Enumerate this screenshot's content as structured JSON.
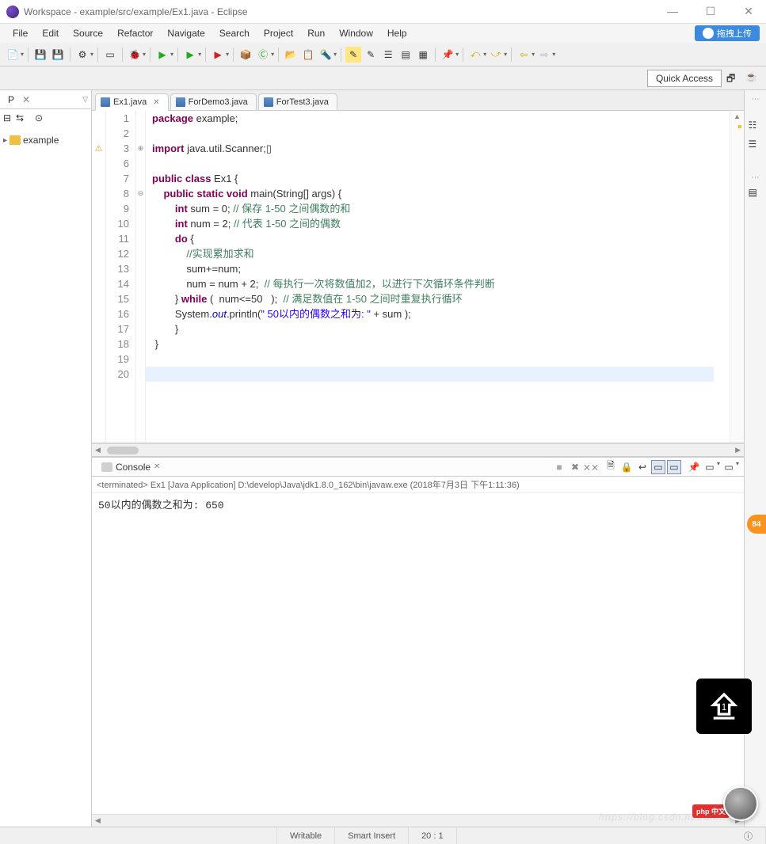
{
  "window": {
    "title": "Workspace - example/src/example/Ex1.java - Eclipse"
  },
  "menu": {
    "items": [
      "File",
      "Edit",
      "Source",
      "Refactor",
      "Navigate",
      "Search",
      "Project",
      "Run",
      "Window",
      "Help"
    ],
    "upload_label": "拖拽上传"
  },
  "quick_access": {
    "label": "Quick Access"
  },
  "explorer": {
    "tab": "P",
    "project": "example"
  },
  "editor": {
    "tabs": [
      {
        "name": "Ex1.java",
        "active": true
      },
      {
        "name": "ForDemo3.java",
        "active": false
      },
      {
        "name": "ForTest3.java",
        "active": false
      }
    ],
    "lines": [
      {
        "n": 1,
        "html": "<span class='k'>package</span> example;"
      },
      {
        "n": 2,
        "html": ""
      },
      {
        "n": 3,
        "html": "<span class='k'>import</span> java.util.Scanner;▯",
        "annot": "warn",
        "fold": "⊕"
      },
      {
        "n": 6,
        "html": ""
      },
      {
        "n": 7,
        "html": "<span class='k'>public class</span> Ex1 {"
      },
      {
        "n": 8,
        "html": "    <span class='k'>public static void</span> main(String[] args) {",
        "fold": "⊖"
      },
      {
        "n": 9,
        "html": "        <span class='k'>int</span> sum = 0; <span class='c'>// 保存 1-50 之间偶数的和</span>"
      },
      {
        "n": 10,
        "html": "        <span class='k'>int</span> num = 2; <span class='c'>// 代表 1-50 之间的偶数</span>"
      },
      {
        "n": 11,
        "html": "        <span class='k'>do</span> {"
      },
      {
        "n": 12,
        "html": "            <span class='c'>//实现累加求和</span>"
      },
      {
        "n": 13,
        "html": "            sum+=num;"
      },
      {
        "n": 14,
        "html": "            num = num + 2;  <span class='c'>// 每执行一次将数值加2，以进行下次循环条件判断</span>"
      },
      {
        "n": 15,
        "html": "        } <span class='k'>while</span> (  num&lt;=50   );  <span class='c'>// 满足数值在 1-50 之间时重复执行循环</span>"
      },
      {
        "n": 16,
        "html": "        System.<span class='f'>out</span>.println(<span class='s'>\" 50以内的偶数之和为: \"</span> + sum );"
      },
      {
        "n": 17,
        "html": "        }"
      },
      {
        "n": 18,
        "html": " }"
      },
      {
        "n": 19,
        "html": ""
      },
      {
        "n": 20,
        "html": "",
        "current": true
      }
    ]
  },
  "console": {
    "title": "Console",
    "info": "<terminated> Ex1 [Java Application] D:\\develop\\Java\\jdk1.8.0_162\\bin\\javaw.exe (2018年7月3日 下午1:11:36)",
    "output": " 50以内的偶数之和为: 650"
  },
  "status": {
    "writable": "Writable",
    "insert": "Smart Insert",
    "pos": "20 : 1"
  },
  "badge": {
    "value": "84"
  },
  "watermark": "https://blog.csdn.net/an...",
  "php_badge": "php 中文"
}
